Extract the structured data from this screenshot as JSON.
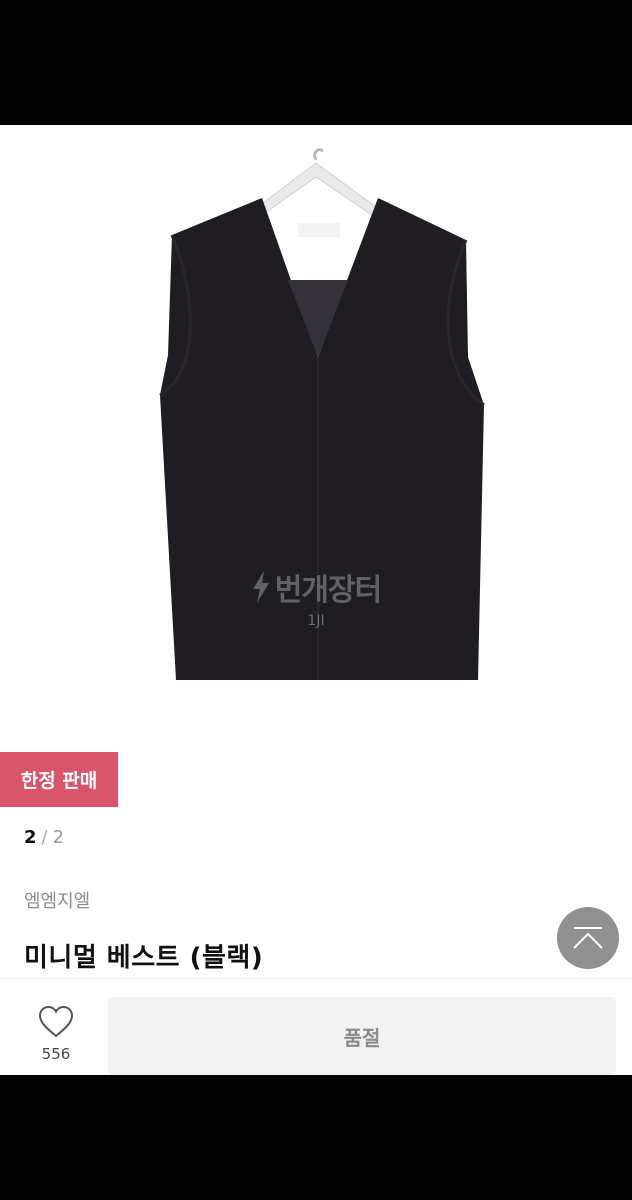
{
  "product": {
    "watermark_text": "번개장터",
    "watermark_sub": "1JI",
    "badge": "한정 판매",
    "pager": {
      "current": "2",
      "separator": "/",
      "total": "2"
    },
    "brand": "엠엠지엘",
    "title": "미니멀 베스트 (블랙)"
  },
  "actions": {
    "like_count": "556",
    "buy_label": "품절"
  },
  "icons": {
    "watermark": "lightning-bolt-icon",
    "scroll_top": "chevron-up-icon",
    "like": "heart-icon"
  },
  "colors": {
    "badge_bg": "#d8556a",
    "vest": "#1f1d22",
    "button_bg": "#f2f2f2"
  }
}
